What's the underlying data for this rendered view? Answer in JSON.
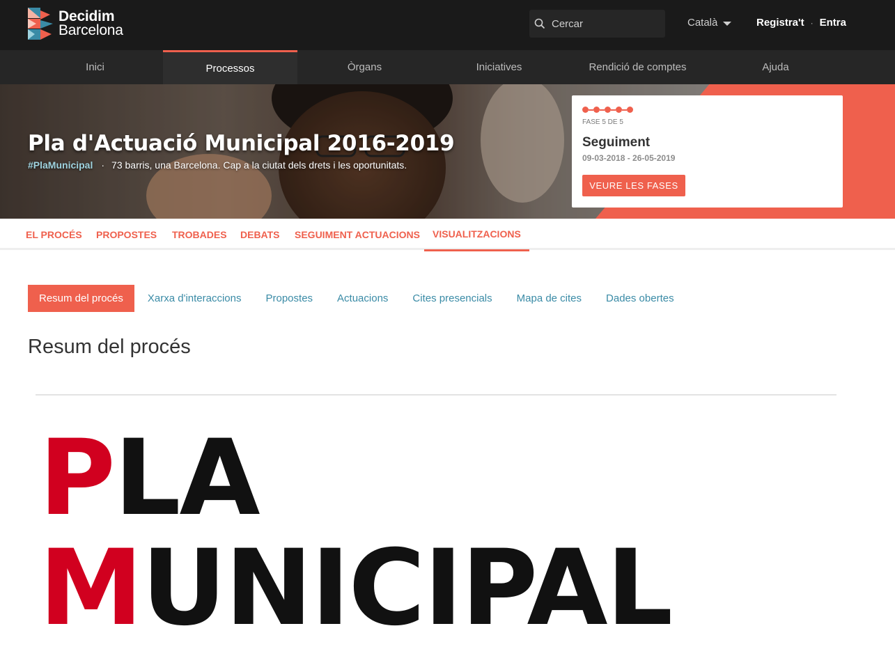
{
  "brand": {
    "line1": "Decidim",
    "line2": "Barcelona",
    "colors": {
      "red": "#ef604d",
      "teal": "#3a8ba6",
      "dark": "#1a1a1a"
    }
  },
  "search": {
    "placeholder": "Cercar",
    "icon": "search-icon"
  },
  "language": {
    "current": "Català"
  },
  "auth": {
    "register": "Registra't",
    "separator": "·",
    "login": "Entra"
  },
  "main_nav": [
    {
      "label": "Inici"
    },
    {
      "label": "Processos",
      "active": true
    },
    {
      "label": "Òrgans"
    },
    {
      "label": "Iniciatives"
    },
    {
      "label": "Rendició de comptes"
    },
    {
      "label": "Ajuda"
    }
  ],
  "hero": {
    "title": "Pla d'Actuació Municipal 2016-2019",
    "hashtag": "#PlaMunicipal",
    "separator": "·",
    "subtitle": "73 barris, una Barcelona. Cap a la ciutat dels drets i les oportunitats."
  },
  "phase": {
    "label": "FASE 5 DE 5",
    "current": 5,
    "total": 5,
    "name": "Seguiment",
    "dates": "09-03-2018 - 26-05-2019",
    "button": "VEURE LES FASES"
  },
  "process_tabs": [
    {
      "label": "EL PROCÉS"
    },
    {
      "label": "PROPOSTES"
    },
    {
      "label": "TROBADES"
    },
    {
      "label": "DEBATS"
    },
    {
      "label": "SEGUIMENT ACTUACIONS"
    },
    {
      "label": "VISUALITZACIONS",
      "active": true
    }
  ],
  "sub_tabs": [
    {
      "label": "Resum del procés",
      "active": true
    },
    {
      "label": "Xarxa d'interaccions"
    },
    {
      "label": "Propostes"
    },
    {
      "label": "Actuacions"
    },
    {
      "label": "Cites presencials"
    },
    {
      "label": "Mapa de cites"
    },
    {
      "label": "Dades obertes"
    }
  ],
  "content": {
    "heading": "Resum del procés",
    "big_line1_first": "P",
    "big_line1_rest": "LA",
    "big_line2_first": "M",
    "big_line2_rest": "UNICIPAL"
  }
}
